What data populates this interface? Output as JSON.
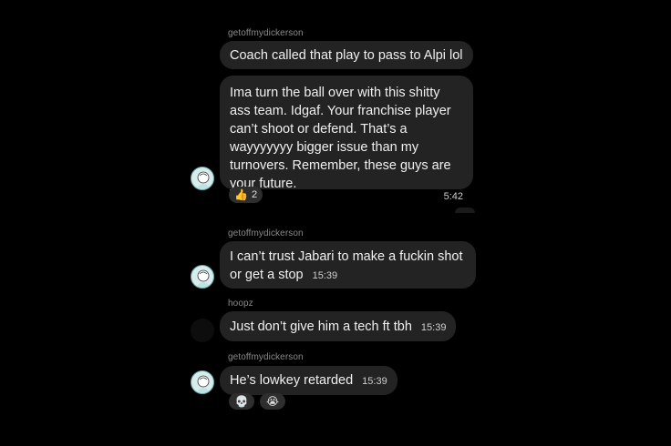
{
  "messages": [
    {
      "sender": "getoffmydickerson",
      "text": "Coach called that play to pass to Alpi lol"
    },
    {
      "text": "Ima turn the ball over with this shitty ass team. Idgaf. Your franchise player can’t shoot or defend. That’s a wayyyyyyy bigger issue than my turnovers. Remember, these guys are your future.",
      "time": "5:42",
      "reactions": [
        {
          "emoji": "👍",
          "count": "2"
        }
      ]
    },
    {
      "sender": "getoffmydickerson",
      "text": "I can’t trust Jabari to make a fuckin shot or get a stop",
      "time": "15:39"
    },
    {
      "sender": "hoopz",
      "text": "Just don’t give him a tech ft tbh",
      "time": "15:39"
    },
    {
      "sender": "getoffmydickerson",
      "text": "He’s lowkey retarded",
      "time": "15:39",
      "reactions": [
        {
          "emoji": "💀"
        },
        {
          "emoji": "😭"
        }
      ]
    }
  ]
}
